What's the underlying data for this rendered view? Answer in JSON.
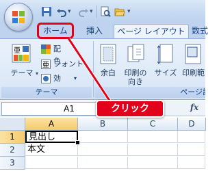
{
  "ribbon_tabs": [
    {
      "label": "ホーム",
      "state": "highlighted"
    },
    {
      "label": "挿入",
      "state": "normal"
    },
    {
      "label": "ページ レイアウト",
      "state": "active"
    },
    {
      "label": "数式",
      "state": "normal"
    }
  ],
  "themes_group": {
    "label": "テーマ",
    "themes_button": "テーマ",
    "colors_button": "配色",
    "fonts_button": "フォント",
    "effects_button": "効果"
  },
  "page_setup_group": {
    "label": "ページ設定",
    "margins_button": "余白",
    "orientation_line1": "印刷の",
    "orientation_line2": "向き",
    "size_button": "サイズ",
    "print_area_button": "印刷範"
  },
  "formula_bar": {
    "name_box": "A1",
    "fx_label": "fx"
  },
  "sheet": {
    "columns": [
      "A",
      "B",
      "C",
      "D"
    ],
    "rows": [
      {
        "row": "1",
        "A": "見出し"
      },
      {
        "row": "2",
        "A": "本文"
      },
      {
        "row": "3",
        "A": ""
      }
    ]
  },
  "callout": {
    "text": "クリック",
    "color": "#e3001b"
  },
  "colors": {
    "tab_text": "#15428b",
    "ribbon_bg": "#dde9f8",
    "selected_header": "#f5c96d"
  }
}
